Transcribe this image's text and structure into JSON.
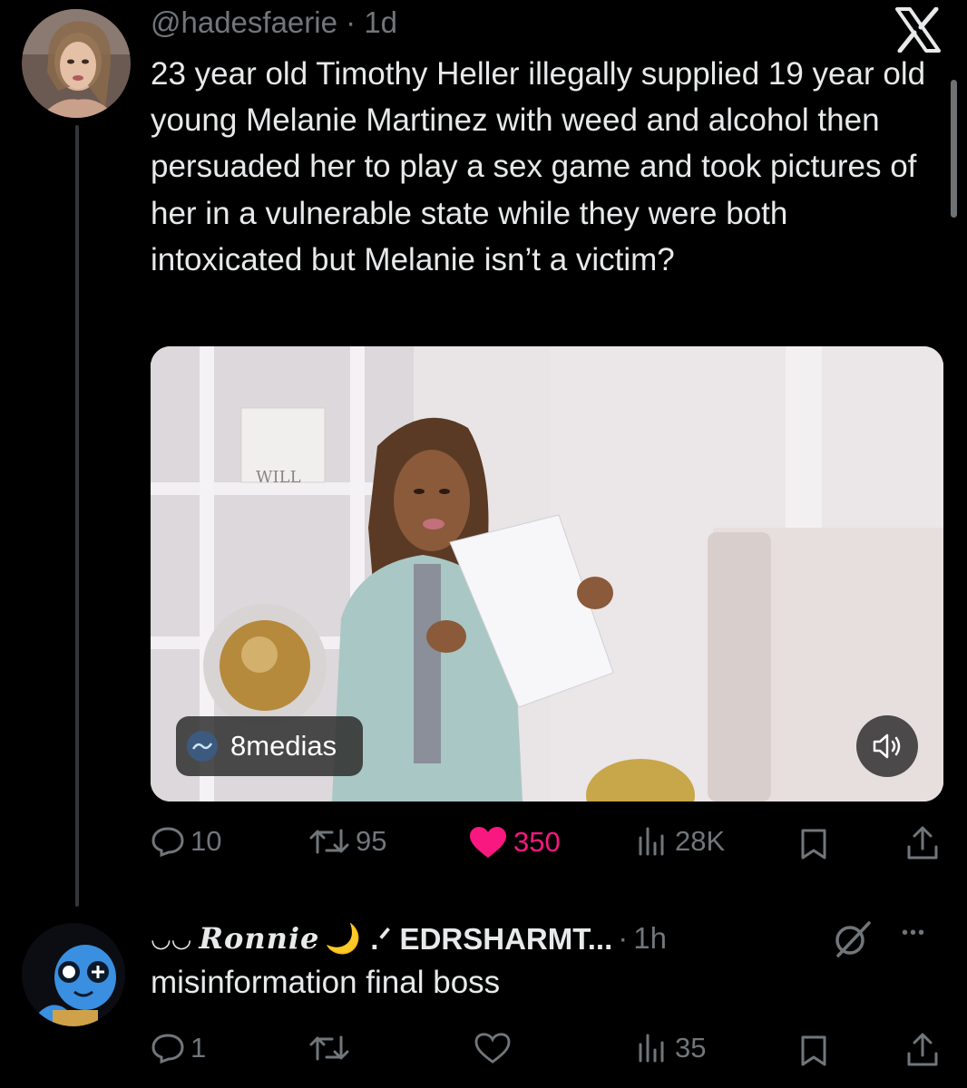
{
  "tweet": {
    "handle": "@hadesfaerie",
    "separator": "·",
    "time": "1d",
    "text": "23 year old Timothy Heller illegally supplied 19 year old young Melanie Martinez with weed and alcohol then persuaded her to play a sex game and took pictures of her in a vulnerable state while they were both intoxicated but Melanie isn’t a victim?",
    "media": {
      "source_label": "8medias",
      "sign_text": "WILL"
    },
    "actions": {
      "replies": "10",
      "reposts": "95",
      "likes": "350",
      "views": "28K"
    },
    "like_color": "#f91880"
  },
  "reply": {
    "display_prefix": "◡◡",
    "display_fancy": "Ronnie",
    "moon": "🌙",
    "display_suffix": ".ᐟ EDRSHARMT...",
    "separator": "·",
    "time": "1h",
    "more_label": "•••",
    "text": "misinformation final boss",
    "actions": {
      "replies": "1",
      "reposts": "",
      "likes": "",
      "views": "35"
    }
  },
  "colors": {
    "background": "#000000",
    "text": "#e7e9ea",
    "muted": "#71767b",
    "accent_pink": "#f91880"
  },
  "icons": [
    "x-logo-icon",
    "reply-icon",
    "repost-icon",
    "like-icon",
    "views-icon",
    "bookmark-icon",
    "share-icon",
    "mute-icon",
    "grok-icon",
    "more-icon"
  ]
}
